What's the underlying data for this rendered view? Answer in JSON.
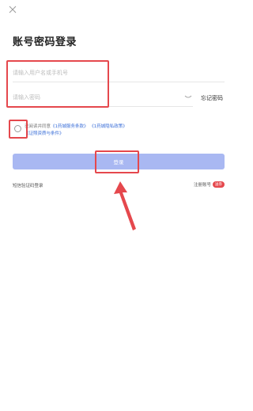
{
  "page": {
    "title": "账号密码登录"
  },
  "form": {
    "username_placeholder": "请输入用户名或手机号",
    "password_placeholder": "请输入密码",
    "forgot_password": "忘记密码"
  },
  "agreement": {
    "prefix": "已阅读并同意",
    "service_terms": "《1药城服务条款》",
    "privacy_policy": "《1药城隐私政策》",
    "cert_label": "《证照资质与条件》"
  },
  "login_button": "登录",
  "footer": {
    "sms_login": "短信验证码登录",
    "register": "注册账号",
    "register_badge": "送券"
  },
  "colors": {
    "accent_button": "#a9b8f2",
    "annotation_red": "#e5484d",
    "link_blue": "#3b6fd8"
  }
}
